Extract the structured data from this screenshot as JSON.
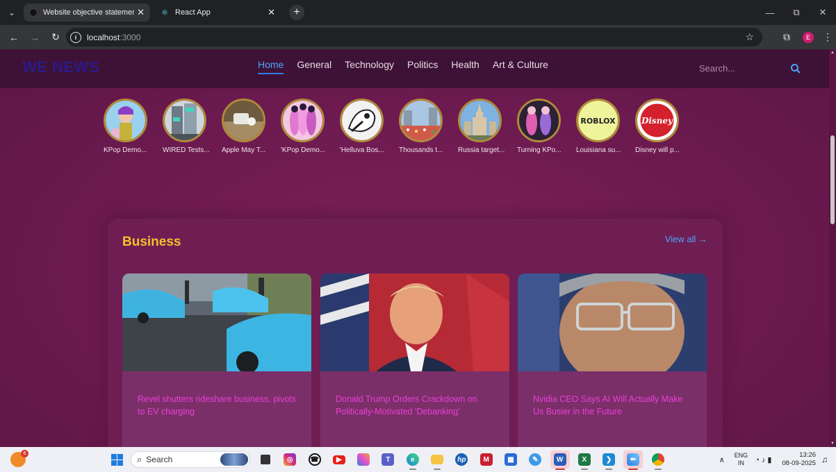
{
  "browser": {
    "tabs": [
      {
        "title": "Website objective statement",
        "favicon": "dark-circle"
      },
      {
        "title": "React App",
        "favicon": "react-icon"
      }
    ],
    "url_host": "localhost",
    "url_port": ":3000"
  },
  "site": {
    "brand": "WE NEWS",
    "nav": [
      {
        "label": "Home",
        "active": true
      },
      {
        "label": "General",
        "active": false
      },
      {
        "label": "Technology",
        "active": false
      },
      {
        "label": "Politics",
        "active": false
      },
      {
        "label": "Health",
        "active": false
      },
      {
        "label": "Art & Culture",
        "active": false
      }
    ],
    "search_placeholder": "Search...",
    "accent": "#4ea3ff",
    "section_title_color": "#f5c02a",
    "headline_color": "#e93fd8"
  },
  "stories": [
    {
      "caption": "KPop Demo..."
    },
    {
      "caption": "WIRED Tests..."
    },
    {
      "caption": "Apple May T..."
    },
    {
      "caption": "'KPop Demo..."
    },
    {
      "caption": "'Helluva Bos..."
    },
    {
      "caption": "Thousands t..."
    },
    {
      "caption": "Russia target..."
    },
    {
      "caption": "Turning KPo..."
    },
    {
      "caption": "Louisiana su..."
    },
    {
      "caption": "Disney will p..."
    }
  ],
  "story_logos": {
    "roblox": "ROBLOX",
    "disney": "Disney"
  },
  "business": {
    "title": "Business",
    "view_all": "View all →",
    "cards": [
      {
        "headline": "Revel shutters rideshare business, pivots to EV charging"
      },
      {
        "headline": "Donald Trump Orders Crackdown on Politically-Motivated 'Debanking'"
      },
      {
        "headline": "Nvidia CEO Says AI Will Actually Make Us Busier in the Future"
      }
    ]
  },
  "taskbar": {
    "widget_badge": "6",
    "search_label": "Search",
    "lang_line1": "ENG",
    "lang_line2": "IN",
    "time": "13:26",
    "date": "08-09-2025",
    "apps": [
      "store-icon",
      "media-icon",
      "instagram-icon",
      "whatsapp-icon",
      "youtube-icon",
      "copilot-icon",
      "teams-icon",
      "edge-icon",
      "file-explorer-icon",
      "hp-icon",
      "mcafee-icon",
      "microsoft-store-icon",
      "notepad-icon",
      "word-icon",
      "excel-icon",
      "vscode-icon",
      "paint-icon",
      "chrome-icon"
    ]
  }
}
